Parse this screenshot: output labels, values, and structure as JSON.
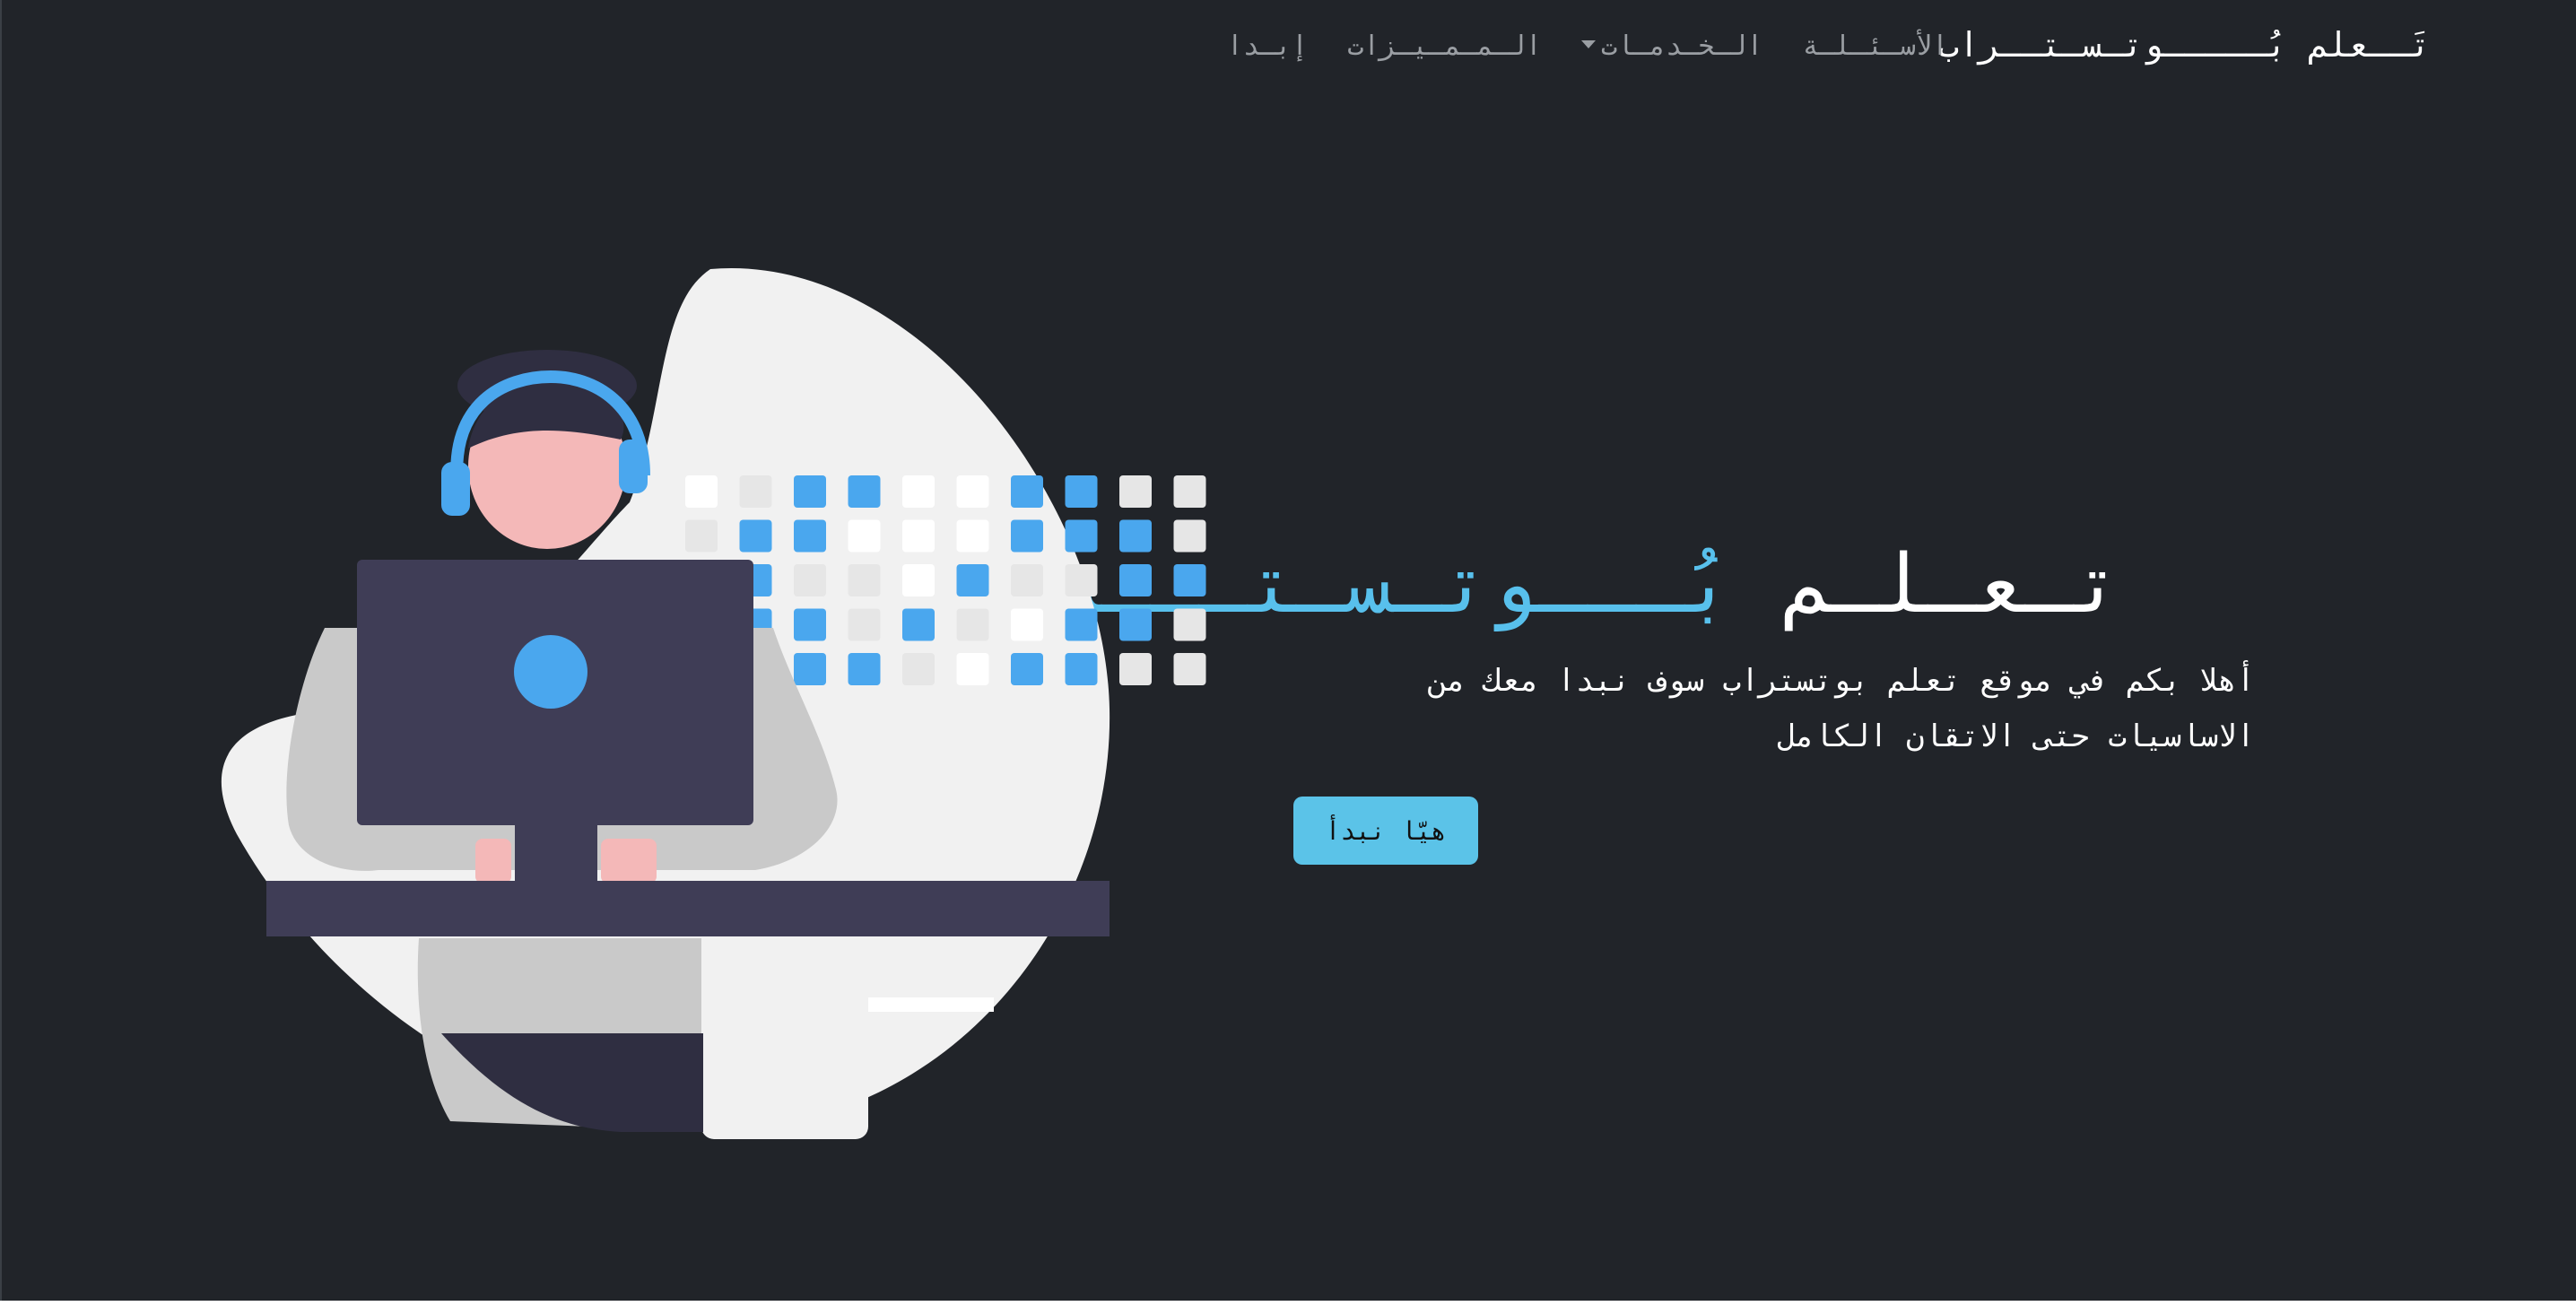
{
  "nav": {
    "brand": "تَــعلم بُـــــوتـسـتــراب",
    "links": [
      {
        "label": "إبـدا"
      },
      {
        "label": "الـمـمـيـزات"
      },
      {
        "label": "الـخـدمـات",
        "has_dropdown": true
      },
      {
        "label": "الأسـئـلـة"
      }
    ]
  },
  "hero": {
    "title_main": "تـعـلـم ",
    "title_accent": "بُـــوتـسـتـــراب",
    "text": "أهلا بكم في موقع تعلم بوتستراب سوف نبدا معك من الاساسيات حتى الاتقان الكامل",
    "cta_label": "هيّا نبدأ"
  },
  "colors": {
    "background": "#212429",
    "accent": "#58c0ec",
    "button": "#5bc3e8",
    "illustration_blue": "#4aa7ee",
    "illustration_dark": "#3f3d56"
  },
  "icons": {
    "illustration": "person-at-computer-illustration"
  }
}
